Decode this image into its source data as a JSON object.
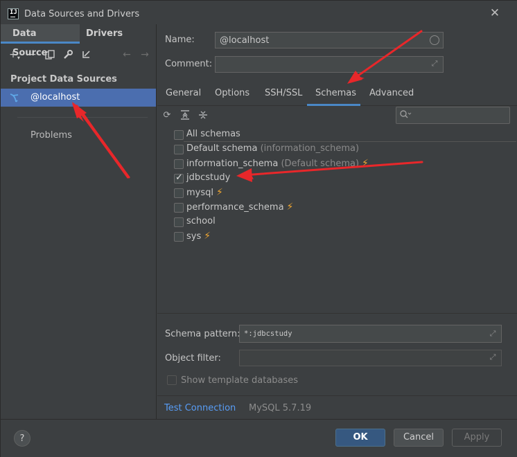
{
  "window": {
    "title": "Data Sources and Drivers",
    "app_icon_text": "IJ"
  },
  "left_tabs": [
    {
      "label": "Data Sources",
      "active": true
    },
    {
      "label": "Drivers",
      "active": false
    }
  ],
  "left_toolbar": {
    "icons": [
      "add-icon",
      "remove-icon",
      "duplicate-icon",
      "wrench-icon",
      "move-to-icon",
      "back-arrow-icon",
      "forward-arrow-icon"
    ]
  },
  "left_panel": {
    "section_title": "Project Data Sources",
    "data_source": "@localhost",
    "problems_label": "Problems"
  },
  "form": {
    "name_label": "Name:",
    "name_value": "@localhost",
    "comment_label": "Comment:",
    "comment_value": ""
  },
  "right_tabs": [
    {
      "label": "General",
      "active": false
    },
    {
      "label": "Options",
      "active": false
    },
    {
      "label": "SSH/SSL",
      "active": false
    },
    {
      "label": "Schemas",
      "active": true
    },
    {
      "label": "Advanced",
      "active": false
    }
  ],
  "schema_toolbar": {
    "icons": [
      "refresh-icon",
      "expand-all-icon",
      "collapse-all-icon"
    ],
    "search_placeholder": ""
  },
  "schemas": {
    "all_label": "All schemas",
    "items": [
      {
        "name": "Default schema",
        "hint": "(information_schema)",
        "checked": false,
        "bolt": false
      },
      {
        "name": "information_schema",
        "hint": "(Default schema)",
        "checked": false,
        "bolt": true
      },
      {
        "name": "jdbcstudy",
        "hint": "",
        "checked": true,
        "bolt": false
      },
      {
        "name": "mysql",
        "hint": "",
        "checked": false,
        "bolt": true
      },
      {
        "name": "performance_schema",
        "hint": "",
        "checked": false,
        "bolt": true
      },
      {
        "name": "school",
        "hint": "",
        "checked": false,
        "bolt": false
      },
      {
        "name": "sys",
        "hint": "",
        "checked": false,
        "bolt": true
      }
    ]
  },
  "filters": {
    "schema_pattern_label": "Schema pattern:",
    "schema_pattern_value": "*:jdbcstudy",
    "object_filter_label": "Object filter:",
    "object_filter_value": "",
    "show_template_label": "Show template databases"
  },
  "status": {
    "test_connection": "Test Connection",
    "db_version": "MySQL 5.7.19"
  },
  "buttons": {
    "help": "?",
    "ok": "OK",
    "cancel": "Cancel",
    "apply": "Apply"
  },
  "colors": {
    "accent": "#4a88c7",
    "selection": "#4b6eaf",
    "bolt": "#f0a732",
    "annotation": "#e8272a",
    "link": "#589df6"
  }
}
